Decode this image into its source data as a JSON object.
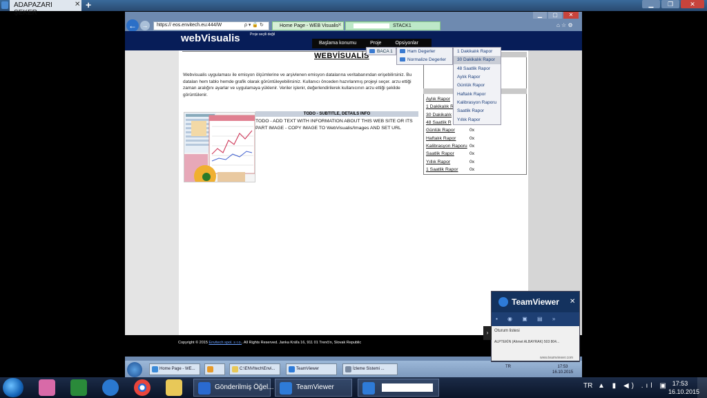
{
  "remote": {
    "tab_title": "ADAPAZARI ŞEKER",
    "tab_close": "✕",
    "add_tab": "+"
  },
  "browser": {
    "address": "https://                eos.envitech.eu:444/W",
    "address_icons": "ρ ▾ 🔒 ↻",
    "tabs": [
      {
        "label": "Home Page - WEB Visualis",
        "close": "✕"
      },
      {
        "label": "STACK1"
      }
    ],
    "right_icons": "⌂ ☆ ⚙"
  },
  "page": {
    "logo": "webVisualis",
    "project_note": "Proje seçili değil",
    "menu": [
      "Başlama konumu",
      "Proje",
      "Opsiyonlar"
    ],
    "title": "WEBVİSUALİS",
    "intro": "Webvisualis uygulaması ile emisyon ölçümlerine ve arşivlenen emisyon datalarına veritabanından erişebilirsiniz. Bu dataları hem tablo hemde grafik olarak görüntüleyebilirsiniz. Kullanıcı önceden hazırlanmış projeyi seçer. arzu ettiği zaman aralığını ayarlar ve uygulamaya yüklenir. Veriler işlenir, değerlendirilerek kullanıcının arzu ettiği şekilde görüntülenir.",
    "todo_heading": "TODO - SUBTITLE, DETAILS INFO",
    "todo_text": "TODO - ADD TEXT WITH INFORMATION ABOUT THIS WEB SITE OR ITS PART IMAGE - COPY IMAGE TO WebVisualis/Images AND SET URL"
  },
  "dropdowns": {
    "proje": [
      "BACA 1"
    ],
    "baca": [
      "Ham Degerler",
      "Normalize Degerler"
    ],
    "ham": [
      {
        "label": "1 Dakikalık Rapor",
        "selected": false
      },
      {
        "label": "30 Dakikalık Rapor",
        "selected": true
      },
      {
        "label": "48 Saatlik Rapor",
        "selected": false
      },
      {
        "label": "Aylık Rapor",
        "selected": false
      },
      {
        "label": "Günlük Rapor",
        "selected": false
      },
      {
        "label": "Haftalık Rapor",
        "selected": false
      },
      {
        "label": "Kalibrasyon Raporu",
        "selected": false
      },
      {
        "label": "Saatlik Rapor",
        "selected": false
      },
      {
        "label": "Yıllık Rapor",
        "selected": false
      }
    ]
  },
  "reports": [
    {
      "label": "Aylık Rapor",
      "value": "0x"
    },
    {
      "label": "1 Dakikalık R",
      "value": ""
    },
    {
      "label": "30 Dakikalık",
      "value": ""
    },
    {
      "label": "48 Saatlik R",
      "value": ""
    },
    {
      "label": "Günlük Rapor",
      "value": "0x"
    },
    {
      "label": "Haftalık Rapor",
      "value": "0x"
    },
    {
      "label": "Kalibrasyon Raporu",
      "value": "0x"
    },
    {
      "label": "Saatlik Rapor",
      "value": "0x"
    },
    {
      "label": "Yıllık Rapor",
      "value": "0x"
    },
    {
      "label": "1 Saatlik Rapor",
      "value": "0x"
    }
  ],
  "footer": {
    "prefix": "Copyright © 2015",
    "link": "Envitech spol. s r.o.",
    "suffix": ". All Rights Reserved. Janka Kráľa 16, 911 01 Trenčín, Slovak Republic"
  },
  "remote_taskbar": {
    "items": [
      "Home Page - WE...",
      "",
      "C:\\ENVItech\\Envi...",
      "TeamViewer",
      "İzleme Sistemi ..."
    ],
    "tray": "TR",
    "time": "17:53",
    "date": "16.10.2015"
  },
  "teamviewer": {
    "title": "TeamViewer",
    "close": "✕",
    "toolbar": "▪ ◉ ▣ ▤ »",
    "session_list": "Oturum listesi",
    "user": "ALPTEKİN (Ahmet ALBAYRAK) 503 804...",
    "site": "www.teamviewer.com",
    "expand": "›"
  },
  "taskbar": {
    "items": [
      "Gönderilmiş Öğel...",
      "TeamViewer"
    ],
    "lang": "TR",
    "tray_icons": "▲ ▮ ◀) .ıl ▣",
    "time": "17:53",
    "date": "16.10.2015"
  },
  "colors": {
    "header": "#071d58",
    "accent": "#1a3d7a",
    "taskbar": "#0a1428"
  }
}
